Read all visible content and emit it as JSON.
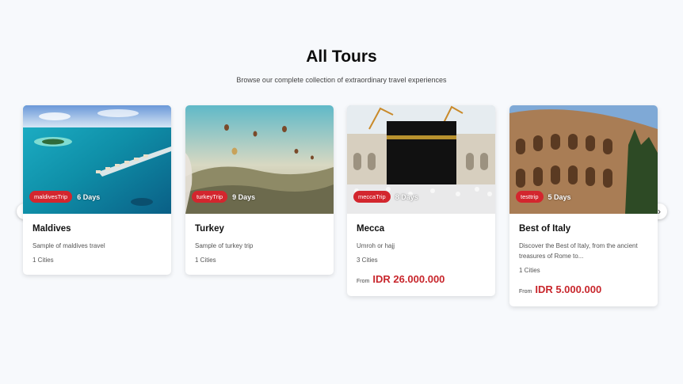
{
  "section": {
    "title": "All Tours",
    "subtitle": "Browse our complete collection of extraordinary travel experiences"
  },
  "tours": [
    {
      "name": "Maldives",
      "tag": "maldivesTrip",
      "duration": "6 Days",
      "description": "Sample of maldives travel",
      "cities": "1 Cities",
      "price_from": "",
      "price": ""
    },
    {
      "name": "Turkey",
      "tag": "turkeyTrip",
      "duration": "9 Days",
      "description": "Sample of turkey trip",
      "cities": "1 Cities",
      "price_from": "",
      "price": ""
    },
    {
      "name": "Mecca",
      "tag": "meccaTrip",
      "duration": "8 Days",
      "description": "Umroh or hajj",
      "cities": "3 Cities",
      "price_from": "From",
      "price": "IDR 26.000.000"
    },
    {
      "name": "Best of Italy",
      "tag": "testtrip",
      "duration": "5 Days",
      "description": "Discover the Best of Italy, from the ancient treasures of Rome to...",
      "cities": "1 Cities",
      "price_from": "From",
      "price": "IDR 5.000.000"
    }
  ],
  "nav": {
    "prev_icon": "chevron-left-icon",
    "next_icon": "chevron-right-icon",
    "prev": "‹",
    "next": "›"
  },
  "colors": {
    "accent": "#c8262c",
    "tag_bg": "#d3262e",
    "page_bg": "#f7f9fc"
  }
}
